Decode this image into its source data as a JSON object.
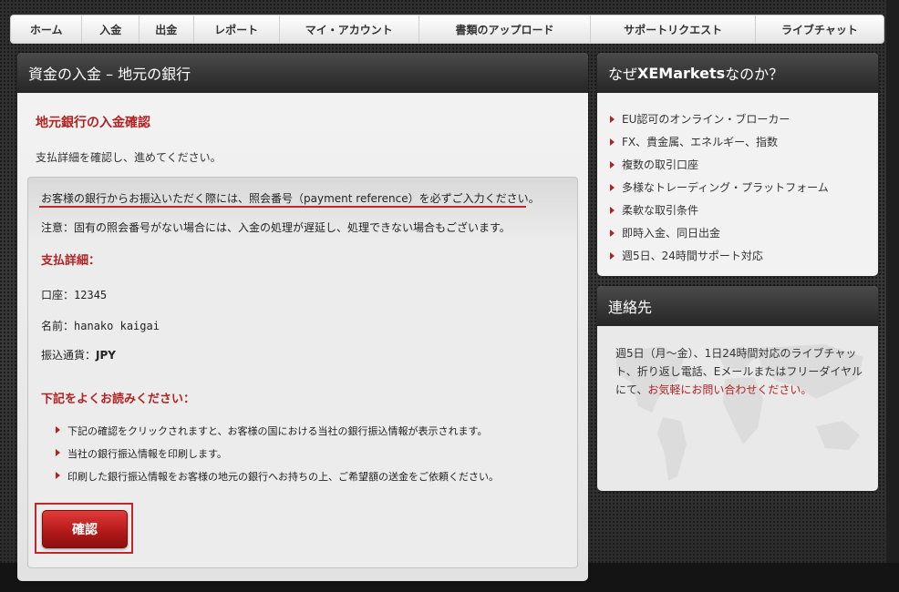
{
  "nav": {
    "items": [
      {
        "label": "ホーム"
      },
      {
        "label": "入金"
      },
      {
        "label": "出金"
      },
      {
        "label": "レポート"
      },
      {
        "label": "マイ・アカウント"
      },
      {
        "label": "書類のアップロード"
      },
      {
        "label": "サポートリクエスト"
      },
      {
        "label": "ライブチャット"
      }
    ]
  },
  "main": {
    "title": "資金の入金 – 地元の銀行",
    "subtitle": "地元銀行の入金確認",
    "intro": "支払詳細を確認し、進めてください。",
    "notice": "お客様の銀行からお振込いただく際には、照会番号（payment reference）を必ずご入力ください。",
    "note": "注意：固有の照会番号がない場合には、入金の処理が遅延し、処理できない場合もございます。",
    "details_title": "支払詳細：",
    "account_label": "口座：",
    "account_value": "12345",
    "name_label": "名前：",
    "name_value": "hanako kaigai",
    "currency_label": "振込通貨：",
    "currency_value": "JPY",
    "read_title": "下記をよくお読みください：",
    "bullets": [
      "下記の確認をクリックされますと、お客様の国における当社の銀行振込情報が表示されます。",
      "当社の銀行振込情報を印刷します。",
      "印刷した銀行振込情報をお客様の地元の銀行へお持ちの上、ご希望額の送金をご依頼ください。"
    ],
    "confirm_label": "確認"
  },
  "why": {
    "title_pre": "なぜ",
    "title_brand": "XEMarkets",
    "title_post": "なのか？",
    "items": [
      "EU認可のオンライン・ブローカー",
      "FX、貴金属、エネルギー、指数",
      "複数の取引口座",
      "多様なトレーディング・プラットフォーム",
      "柔軟な取引条件",
      "即時入金、同日出金",
      "週5日、24時間サポート対応"
    ]
  },
  "contact": {
    "title": "連絡先",
    "text": "週5日（月～金）、1日24時間対応のライブチャット、折り返し電話、Eメールまたはフリーダイヤルにて、",
    "link": "お気軽にお問い合わせください。"
  },
  "colors": {
    "accent": "#b22222",
    "header_dark": "#262626",
    "button_red": "#c0262c"
  }
}
